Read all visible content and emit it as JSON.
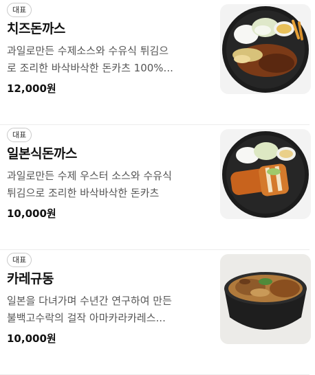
{
  "menu": {
    "items": [
      {
        "badge": "대표",
        "name": "치즈돈까스",
        "desc_line1": "과일로만든 수제소스와 수유식 튀김으",
        "desc_line2": "로 조리한 바삭바삭한 돈카츠 100%...",
        "price": "12,000원",
        "image_icon": "cheese-pork-cutlet-plate"
      },
      {
        "badge": "대표",
        "name": "일본식돈까스",
        "desc_line1": "과일로만든 수제 우스터 소스와 수유식",
        "desc_line2": "튀김으로 조리한 바삭바삭한 돈카츠",
        "price": "10,000원",
        "image_icon": "japanese-pork-cutlet-plate"
      },
      {
        "badge": "대표",
        "name": "카레규동",
        "desc_line1": "일본을 다녀가며 수년간 연구하여 만든",
        "desc_line2": "불백고수락의 걸작 아마카라카레스...",
        "price": "10,000원",
        "image_icon": "curry-beef-bowl"
      }
    ]
  }
}
